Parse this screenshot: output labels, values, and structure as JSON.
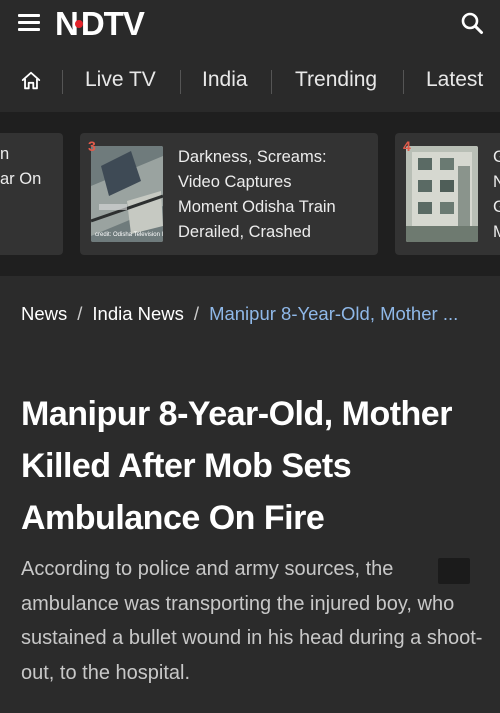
{
  "header": {
    "logo_text": "NDTV",
    "logo_dot_color": "#e2232a",
    "menu_icon": "hamburger-menu-icon",
    "search_icon": "search-icon"
  },
  "nav": {
    "home_icon": "home-icon",
    "items": [
      "Live TV",
      "India",
      "Trending",
      "Latest"
    ]
  },
  "trending": {
    "cards": [
      {
        "rank": "",
        "lines": [
          "n",
          "ar On"
        ]
      },
      {
        "rank": "3",
        "lines": [
          "Darkness, Screams:",
          "Video Captures",
          "Moment Odisha Train",
          "Derailed, Crashed"
        ],
        "image_credit": "credit: Odisha Television l"
      },
      {
        "rank": "4",
        "lines": [
          "G",
          "N",
          "G",
          "M"
        ]
      }
    ]
  },
  "breadcrumb": {
    "items": [
      "News",
      "India News"
    ],
    "current": "Manipur 8-Year-Old, Mother ..."
  },
  "article": {
    "headline": "Manipur 8-Year-Old, Mother Killed After Mob Sets Ambulance On Fire",
    "summary": "According to police and army sources, the ambulance was transporting the injured boy, who sustained a bullet wound in his head during a shoot-out, to the hospital."
  },
  "colors": {
    "background": "#2b2b2b",
    "strip_background": "#1f1f1f",
    "card_background": "#333333",
    "link_blue": "#8fb8e8",
    "rank_red": "#e05a4a"
  }
}
